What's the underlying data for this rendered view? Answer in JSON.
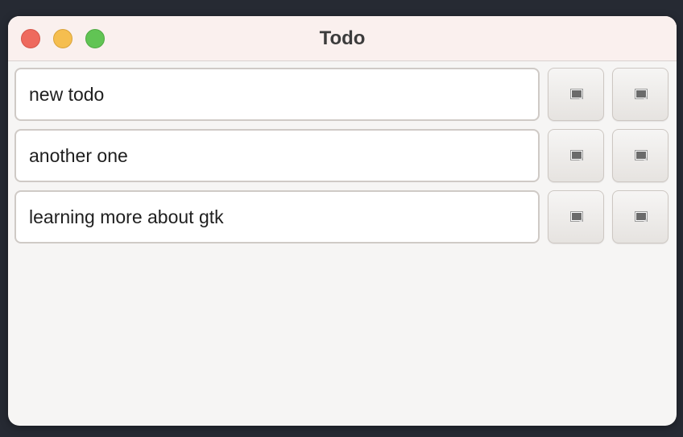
{
  "window": {
    "title": "Todo"
  },
  "todos": [
    {
      "text": "new todo"
    },
    {
      "text": "another one"
    },
    {
      "text": "learning more about gtk"
    }
  ],
  "icons": {
    "row_button_icon": "missing-image-icon"
  },
  "colors": {
    "close": "#ee6a5e",
    "minimize": "#f5be4f",
    "maximize": "#61c454",
    "titlebar": "#faf0ee",
    "window_bg": "#f6f5f4"
  }
}
